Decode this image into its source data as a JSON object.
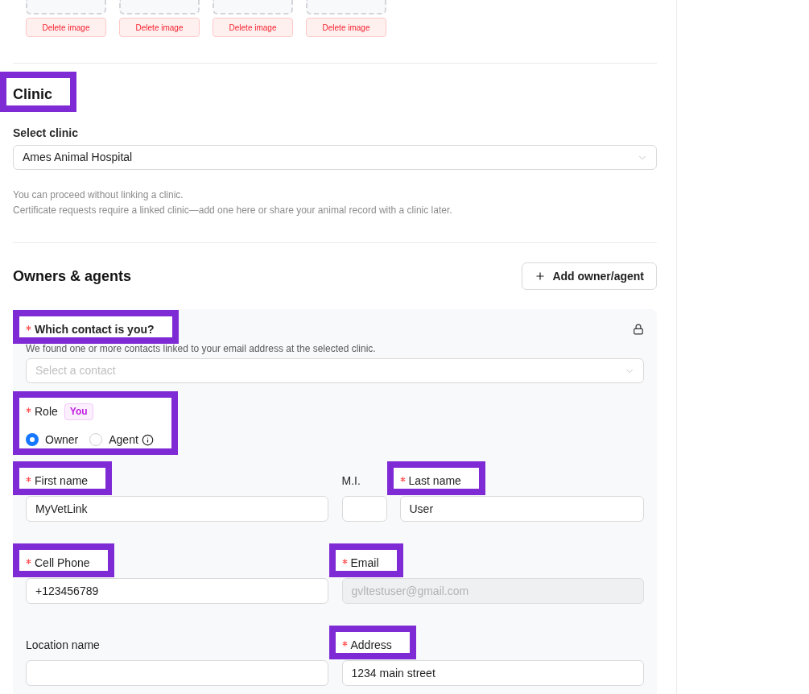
{
  "image_slots": [
    {
      "delete_label": "Delete image"
    },
    {
      "delete_label": "Delete image"
    },
    {
      "delete_label": "Delete image"
    },
    {
      "delete_label": "Delete image"
    }
  ],
  "clinic": {
    "title": "Clinic",
    "title_highlighted": true,
    "select_label": "Select clinic",
    "select_value": "Ames Animal Hospital",
    "notes": [
      "You can proceed without linking a clinic.",
      "Certificate requests require a linked clinic—add one here or share your animal record with a clinic later."
    ]
  },
  "owners": {
    "title": "Owners & agents",
    "add_button": "Add owner/agent",
    "contact": {
      "label": "Which contact is you?",
      "required": true,
      "highlighted": true,
      "locked": true,
      "hint": "We found one or more contacts linked to your email address at the selected clinic.",
      "placeholder": "Select a contact"
    },
    "role": {
      "label": "Role",
      "required": true,
      "highlighted": true,
      "badge": "You",
      "options": [
        {
          "label": "Owner",
          "selected": true,
          "info": false
        },
        {
          "label": "Agent",
          "selected": false,
          "info": true
        }
      ]
    },
    "field_rows": [
      [
        {
          "label": "First name",
          "required": true,
          "highlighted": true,
          "disabled": false,
          "value": "MyVetLink"
        },
        {
          "label": "M.I.",
          "required": false,
          "highlighted": false,
          "disabled": false
        },
        {
          "label": "Last name",
          "required": true,
          "highlighted": true,
          "disabled": false,
          "value": "User"
        }
      ],
      [
        {
          "label": "Cell Phone",
          "required": true,
          "highlighted": true,
          "disabled": false,
          "value": "+123456789"
        },
        {
          "label": "Email",
          "required": true,
          "highlighted": true,
          "disabled": true,
          "value": "gvltestuser@gmail.com"
        }
      ],
      [
        {
          "label": "Location name",
          "required": false,
          "highlighted": false,
          "disabled": false
        },
        {
          "label": "Address",
          "required": true,
          "highlighted": true,
          "disabled": false,
          "value": "1234 main street"
        }
      ]
    ]
  }
}
